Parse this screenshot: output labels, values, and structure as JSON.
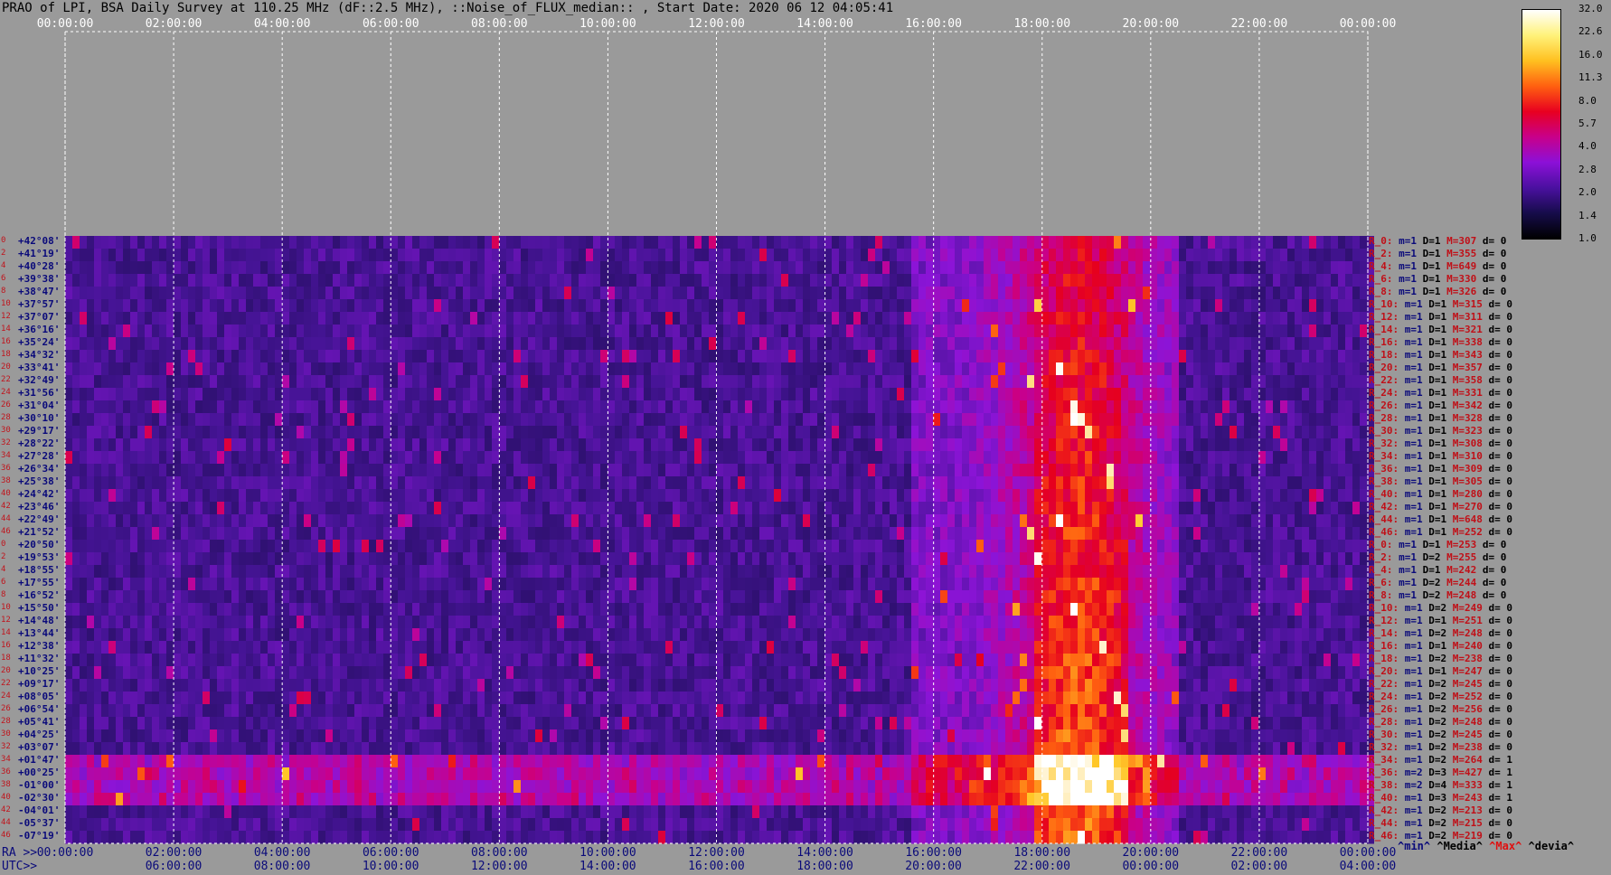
{
  "title": "PRAO of LPI, BSA Daily Survey at 110.25 MHz (dF::2.5 MHz), ::Noise_of_FLUX_median:: , Start Date: 2020 06 12 04:05:41",
  "chart_data": {
    "type": "heatmap",
    "title": "PRAO of LPI, BSA Daily Survey at 110.25 MHz (dF::2.5 MHz), ::Noise_of_FLUX_median:: , Start Date: 2020 06 12 04:05:41",
    "x_top_ticks": [
      "00:00:00",
      "02:00:00",
      "04:00:00",
      "06:00:00",
      "08:00:00",
      "10:00:00",
      "12:00:00",
      "14:00:00",
      "16:00:00",
      "18:00:00",
      "20:00:00",
      "22:00:00",
      "00:00:00"
    ],
    "ra_label": "RA >>",
    "utc_label": "UTC>>",
    "ra_ticks": [
      "00:00:00",
      "02:00:00",
      "04:00:00",
      "06:00:00",
      "08:00:00",
      "10:00:00",
      "12:00:00",
      "14:00:00",
      "16:00:00",
      "18:00:00",
      "20:00:00",
      "22:00:00",
      "00:00:00"
    ],
    "utc_ticks": [
      "06:00:00",
      "08:00:00",
      "10:00:00",
      "12:00:00",
      "14:00:00",
      "16:00:00",
      "18:00:00",
      "20:00:00",
      "22:00:00",
      "00:00:00",
      "02:00:00",
      "04:00:00"
    ],
    "colorbar_ticks": [
      "32.0",
      "22.6",
      "16.0",
      "11.3",
      "8.0",
      "5.7",
      "4.0",
      "2.8",
      "2.0",
      "1.4",
      "1.0"
    ],
    "colorbar_colors": [
      "#ffffff",
      "#fff27a",
      "#ffc020",
      "#ff6010",
      "#e80020",
      "#c8008a",
      "#8c10d8",
      "#4a10a0",
      "#160c4a",
      "#000000"
    ],
    "dec_labels": [
      "+42°08'",
      "+41°19'",
      "+40°28'",
      "+39°38'",
      "+38°47'",
      "+37°57'",
      "+37°07'",
      "+36°16'",
      "+35°24'",
      "+34°32'",
      "+33°41'",
      "+32°49'",
      "+31°56'",
      "+31°04'",
      "+30°10'",
      "+29°17'",
      "+28°22'",
      "+27°28'",
      "+26°34'",
      "+25°38'",
      "+24°42'",
      "+23°46'",
      "+22°49'",
      "+21°52'",
      "+20°50'",
      "+19°53'",
      "+18°55'",
      "+17°55'",
      "+16°52'",
      "+15°50'",
      "+14°48'",
      "+13°44'",
      "+12°38'",
      "+11°32'",
      "+10°25'",
      "+09°17'",
      "+08°05'",
      "+06°54'",
      "+05°41'",
      "+04°25'",
      "+03°07'",
      "+01°47'",
      "+00°25'",
      "-01°00'",
      "-02°30'",
      "-04°01'",
      "-05°37'",
      "-07°19'"
    ],
    "row_index_labels": [
      "0",
      "2",
      "4",
      "6",
      "8",
      "10",
      "12",
      "14",
      "16",
      "18",
      "20",
      "22",
      "24",
      "26",
      "28",
      "30",
      "32",
      "34",
      "36",
      "38",
      "40",
      "42",
      "44",
      "46",
      "0",
      "2",
      "4",
      "6",
      "8",
      "10",
      "12",
      "14",
      "16",
      "18",
      "20",
      "22",
      "24",
      "26",
      "28",
      "30",
      "32",
      "34",
      "36",
      "38",
      "40",
      "42",
      "44",
      "46"
    ],
    "stats": [
      {
        "r": "R_0:",
        "min": "m=1",
        "d": "D=1",
        "max": "M=307",
        "dev": "d= 0"
      },
      {
        "r": "R_2:",
        "min": "m=1",
        "d": "D=1",
        "max": "M=355",
        "dev": "d= 0"
      },
      {
        "r": "R_4:",
        "min": "m=1",
        "d": "D=1",
        "max": "M=649",
        "dev": "d= 0"
      },
      {
        "r": "R_6:",
        "min": "m=1",
        "d": "D=1",
        "max": "M=330",
        "dev": "d= 0"
      },
      {
        "r": "R_8:",
        "min": "m=1",
        "d": "D=1",
        "max": "M=326",
        "dev": "d= 0"
      },
      {
        "r": "R_10:",
        "min": "m=1",
        "d": "D=1",
        "max": "M=315",
        "dev": "d= 0"
      },
      {
        "r": "R_12:",
        "min": "m=1",
        "d": "D=1",
        "max": "M=311",
        "dev": "d= 0"
      },
      {
        "r": "R_14:",
        "min": "m=1",
        "d": "D=1",
        "max": "M=321",
        "dev": "d= 0"
      },
      {
        "r": "R_16:",
        "min": "m=1",
        "d": "D=1",
        "max": "M=338",
        "dev": "d= 0"
      },
      {
        "r": "R_18:",
        "min": "m=1",
        "d": "D=1",
        "max": "M=343",
        "dev": "d= 0"
      },
      {
        "r": "R_20:",
        "min": "m=1",
        "d": "D=1",
        "max": "M=357",
        "dev": "d= 0"
      },
      {
        "r": "R_22:",
        "min": "m=1",
        "d": "D=1",
        "max": "M=358",
        "dev": "d= 0"
      },
      {
        "r": "R_24:",
        "min": "m=1",
        "d": "D=1",
        "max": "M=331",
        "dev": "d= 0"
      },
      {
        "r": "R_26:",
        "min": "m=1",
        "d": "D=1",
        "max": "M=342",
        "dev": "d= 0"
      },
      {
        "r": "R_28:",
        "min": "m=1",
        "d": "D=1",
        "max": "M=328",
        "dev": "d= 0"
      },
      {
        "r": "R_30:",
        "min": "m=1",
        "d": "D=1",
        "max": "M=323",
        "dev": "d= 0"
      },
      {
        "r": "R_32:",
        "min": "m=1",
        "d": "D=1",
        "max": "M=308",
        "dev": "d= 0"
      },
      {
        "r": "R_34:",
        "min": "m=1",
        "d": "D=1",
        "max": "M=310",
        "dev": "d= 0"
      },
      {
        "r": "R_36:",
        "min": "m=1",
        "d": "D=1",
        "max": "M=309",
        "dev": "d= 0"
      },
      {
        "r": "R_38:",
        "min": "m=1",
        "d": "D=1",
        "max": "M=305",
        "dev": "d= 0"
      },
      {
        "r": "R_40:",
        "min": "m=1",
        "d": "D=1",
        "max": "M=280",
        "dev": "d= 0"
      },
      {
        "r": "R_42:",
        "min": "m=1",
        "d": "D=1",
        "max": "M=270",
        "dev": "d= 0"
      },
      {
        "r": "R_44:",
        "min": "m=1",
        "d": "D=1",
        "max": "M=648",
        "dev": "d= 0"
      },
      {
        "r": "R_46:",
        "min": "m=1",
        "d": "D=1",
        "max": "M=252",
        "dev": "d= 0"
      },
      {
        "r": "R_0:",
        "min": "m=1",
        "d": "D=1",
        "max": "M=253",
        "dev": "d= 0"
      },
      {
        "r": "R_2:",
        "min": "m=1",
        "d": "D=2",
        "max": "M=255",
        "dev": "d= 0"
      },
      {
        "r": "R_4:",
        "min": "m=1",
        "d": "D=1",
        "max": "M=242",
        "dev": "d= 0"
      },
      {
        "r": "R_6:",
        "min": "m=1",
        "d": "D=2",
        "max": "M=244",
        "dev": "d= 0"
      },
      {
        "r": "R_8:",
        "min": "m=1",
        "d": "D=2",
        "max": "M=248",
        "dev": "d= 0"
      },
      {
        "r": "R_10:",
        "min": "m=1",
        "d": "D=2",
        "max": "M=249",
        "dev": "d= 0"
      },
      {
        "r": "R_12:",
        "min": "m=1",
        "d": "D=1",
        "max": "M=251",
        "dev": "d= 0"
      },
      {
        "r": "R_14:",
        "min": "m=1",
        "d": "D=2",
        "max": "M=248",
        "dev": "d= 0"
      },
      {
        "r": "R_16:",
        "min": "m=1",
        "d": "D=1",
        "max": "M=240",
        "dev": "d= 0"
      },
      {
        "r": "R_18:",
        "min": "m=1",
        "d": "D=2",
        "max": "M=238",
        "dev": "d= 0"
      },
      {
        "r": "R_20:",
        "min": "m=1",
        "d": "D=1",
        "max": "M=247",
        "dev": "d= 0"
      },
      {
        "r": "R_22:",
        "min": "m=1",
        "d": "D=2",
        "max": "M=245",
        "dev": "d= 0"
      },
      {
        "r": "R_24:",
        "min": "m=1",
        "d": "D=2",
        "max": "M=252",
        "dev": "d= 0"
      },
      {
        "r": "R_26:",
        "min": "m=1",
        "d": "D=2",
        "max": "M=256",
        "dev": "d= 0"
      },
      {
        "r": "R_28:",
        "min": "m=1",
        "d": "D=2",
        "max": "M=248",
        "dev": "d= 0"
      },
      {
        "r": "R_30:",
        "min": "m=1",
        "d": "D=2",
        "max": "M=245",
        "dev": "d= 0"
      },
      {
        "r": "R_32:",
        "min": "m=1",
        "d": "D=2",
        "max": "M=238",
        "dev": "d= 0"
      },
      {
        "r": "R_34:",
        "min": "m=1",
        "d": "D=2",
        "max": "M=264",
        "dev": "d= 1"
      },
      {
        "r": "R_36:",
        "min": "m=2",
        "d": "D=3",
        "max": "M=427",
        "dev": "d= 1"
      },
      {
        "r": "R_38:",
        "min": "m=2",
        "d": "D=4",
        "max": "M=333",
        "dev": "d= 1"
      },
      {
        "r": "R_40:",
        "min": "m=1",
        "d": "D=3",
        "max": "M=243",
        "dev": "d= 1"
      },
      {
        "r": "R_42:",
        "min": "m=1",
        "d": "D=2",
        "max": "M=213",
        "dev": "d= 0"
      },
      {
        "r": "R_44:",
        "min": "m=1",
        "d": "D=2",
        "max": "M=215",
        "dev": "d= 0"
      },
      {
        "r": "R_46:",
        "min": "m=1",
        "d": "D=2",
        "max": "M=219",
        "dev": "d= 0"
      }
    ],
    "legend": {
      "min": "^min^",
      "median": "^Media^",
      "max": "^Max^",
      "dev": "^devia^"
    },
    "legend_colors": {
      "min": "#0a0a7a",
      "median": "#000000",
      "max": "#e01010",
      "dev": "#000000"
    }
  }
}
